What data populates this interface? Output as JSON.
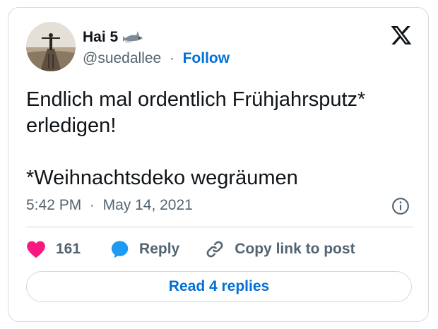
{
  "author": {
    "display_name": "Hai 5",
    "handle": "@suedallee",
    "separator": "·",
    "follow_label": "Follow",
    "emoji_icon": "shark-icon"
  },
  "tweet": {
    "text": "Endlich mal ordentlich Frühjahrsputz*\nerledigen!\n\n*Weihnachtsdeko wegräumen",
    "time": "5:42 PM",
    "separator": "·",
    "date": "May 14, 2021"
  },
  "actions": {
    "like_count": "161",
    "reply_label": "Reply",
    "copy_link_label": "Copy link to post"
  },
  "read_replies_label": "Read 4 replies",
  "colors": {
    "link_blue": "#006fd6",
    "like_pink": "#f91880",
    "reply_blue": "#1d9bf0",
    "text": "#0f1419",
    "muted": "#536471"
  }
}
